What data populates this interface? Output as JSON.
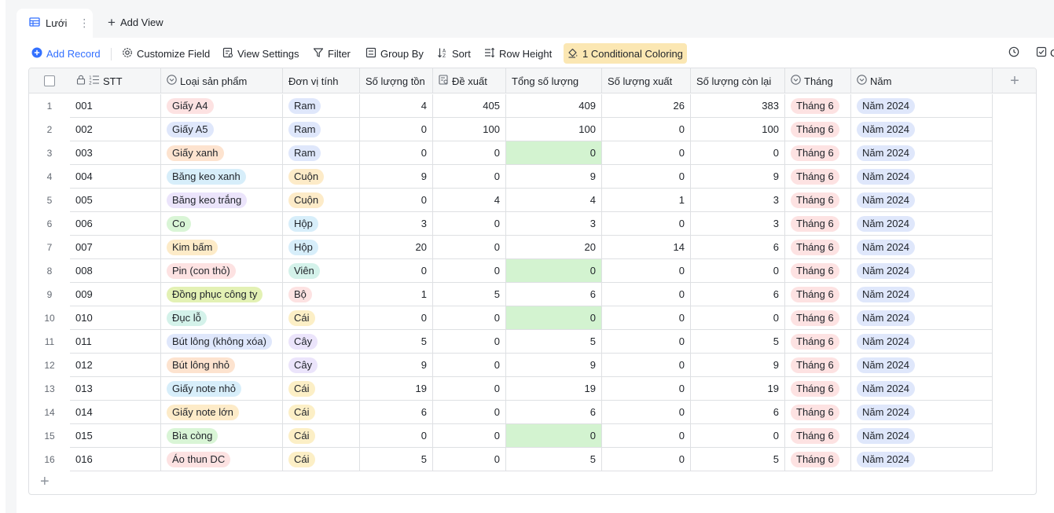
{
  "view_tab": {
    "label": "Lưới",
    "more": "⋮"
  },
  "add_view_label": "Add View",
  "toolbar": {
    "add_record": "Add Record",
    "customize_field": "Customize Field",
    "view_settings": "View Settings",
    "filter": "Filter",
    "group_by": "Group By",
    "sort": "Sort",
    "row_height": "Row Height",
    "conditional_coloring": "1 Conditional Coloring",
    "cut_text": "C"
  },
  "columns": [
    {
      "key": "stt",
      "label": "STT"
    },
    {
      "key": "loai",
      "label": "Loại sản phẩm"
    },
    {
      "key": "dvt",
      "label": "Đơn vị tính"
    },
    {
      "key": "ton",
      "label": "Số lượng tồn"
    },
    {
      "key": "dexuat",
      "label": "Đề xuất"
    },
    {
      "key": "tong",
      "label": "Tổng số lượng"
    },
    {
      "key": "xuat",
      "label": "Số lượng xuất"
    },
    {
      "key": "conlai",
      "label": "Số lượng còn lại"
    },
    {
      "key": "thang",
      "label": "Tháng"
    },
    {
      "key": "nam",
      "label": "Năm"
    }
  ],
  "colors": {
    "accent": "#3370ff",
    "highlight": "#d3f3d0",
    "unit_ram": "#dfe7fb",
    "unit_cuon": "#fdebc8",
    "unit_hop": "#d7eefa",
    "unit_vien": "#d4f2ea",
    "unit_bo": "#fde2e2",
    "unit_cai": "#fcefc6",
    "unit_cay": "#ebe4fb",
    "thang": "#fde2e2",
    "nam": "#dfe7fb"
  },
  "rows": [
    {
      "n": "1",
      "stt": "001",
      "loai": "Giấy A4",
      "loai_color": "#fde2e2",
      "dvt": "Ram",
      "ton": "4",
      "dexuat": "405",
      "tong": "409",
      "xuat": "26",
      "conlai": "383",
      "thang": "Tháng 6",
      "nam": "Năm 2024",
      "hl": false
    },
    {
      "n": "2",
      "stt": "002",
      "loai": "Giấy A5",
      "loai_color": "#dfe7fb",
      "dvt": "Ram",
      "ton": "0",
      "dexuat": "100",
      "tong": "100",
      "xuat": "0",
      "conlai": "100",
      "thang": "Tháng 6",
      "nam": "Năm 2024",
      "hl": false
    },
    {
      "n": "3",
      "stt": "003",
      "loai": "Giấy xanh",
      "loai_color": "#fde3cf",
      "dvt": "Ram",
      "ton": "0",
      "dexuat": "0",
      "tong": "0",
      "xuat": "0",
      "conlai": "0",
      "thang": "Tháng 6",
      "nam": "Năm 2024",
      "hl": true
    },
    {
      "n": "4",
      "stt": "004",
      "loai": "Băng keo xanh",
      "loai_color": "#d7eefa",
      "dvt": "Cuộn",
      "ton": "9",
      "dexuat": "0",
      "tong": "9",
      "xuat": "0",
      "conlai": "9",
      "thang": "Tháng 6",
      "nam": "Năm 2024",
      "hl": false
    },
    {
      "n": "5",
      "stt": "005",
      "loai": "Băng keo trắng",
      "loai_color": "#ebe4fb",
      "dvt": "Cuộn",
      "ton": "0",
      "dexuat": "4",
      "tong": "4",
      "xuat": "1",
      "conlai": "3",
      "thang": "Tháng 6",
      "nam": "Năm 2024",
      "hl": false
    },
    {
      "n": "6",
      "stt": "006",
      "loai": "Co",
      "loai_color": "#d9f5d6",
      "dvt": "Hộp",
      "ton": "3",
      "dexuat": "0",
      "tong": "3",
      "xuat": "0",
      "conlai": "3",
      "thang": "Tháng 6",
      "nam": "Năm 2024",
      "hl": false
    },
    {
      "n": "7",
      "stt": "007",
      "loai": "Kim bấm",
      "loai_color": "#fdebc8",
      "dvt": "Hộp",
      "ton": "20",
      "dexuat": "0",
      "tong": "20",
      "xuat": "14",
      "conlai": "6",
      "thang": "Tháng 6",
      "nam": "Năm 2024",
      "hl": false
    },
    {
      "n": "8",
      "stt": "008",
      "loai": "Pin (con thỏ)",
      "loai_color": "#fde2e2",
      "dvt": "Viên",
      "ton": "0",
      "dexuat": "0",
      "tong": "0",
      "xuat": "0",
      "conlai": "0",
      "thang": "Tháng 6",
      "nam": "Năm 2024",
      "hl": true
    },
    {
      "n": "9",
      "stt": "009",
      "loai": "Đồng phục công ty",
      "loai_color": "#e3f1b4",
      "dvt": "Bộ",
      "ton": "1",
      "dexuat": "5",
      "tong": "6",
      "xuat": "0",
      "conlai": "6",
      "thang": "Tháng 6",
      "nam": "Năm 2024",
      "hl": false
    },
    {
      "n": "10",
      "stt": "010",
      "loai": "Đục lỗ",
      "loai_color": "#d4f2ea",
      "dvt": "Cái",
      "ton": "0",
      "dexuat": "0",
      "tong": "0",
      "xuat": "0",
      "conlai": "0",
      "thang": "Tháng 6",
      "nam": "Năm 2024",
      "hl": true
    },
    {
      "n": "11",
      "stt": "011",
      "loai": "Bút lông (không xóa)",
      "loai_color": "#dfe7fb",
      "dvt": "Cây",
      "ton": "5",
      "dexuat": "0",
      "tong": "5",
      "xuat": "0",
      "conlai": "5",
      "thang": "Tháng 6",
      "nam": "Năm 2024",
      "hl": false
    },
    {
      "n": "12",
      "stt": "012",
      "loai": "Bút lông nhỏ",
      "loai_color": "#fde3cf",
      "dvt": "Cây",
      "ton": "9",
      "dexuat": "0",
      "tong": "9",
      "xuat": "0",
      "conlai": "9",
      "thang": "Tháng 6",
      "nam": "Năm 2024",
      "hl": false
    },
    {
      "n": "13",
      "stt": "013",
      "loai": "Giấy note nhỏ",
      "loai_color": "#d7eefa",
      "dvt": "Cái",
      "ton": "19",
      "dexuat": "0",
      "tong": "19",
      "xuat": "0",
      "conlai": "19",
      "thang": "Tháng 6",
      "nam": "Năm 2024",
      "hl": false
    },
    {
      "n": "14",
      "stt": "014",
      "loai": "Giấy note lớn",
      "loai_color": "#fdebc8",
      "dvt": "Cái",
      "ton": "6",
      "dexuat": "0",
      "tong": "6",
      "xuat": "0",
      "conlai": "6",
      "thang": "Tháng 6",
      "nam": "Năm 2024",
      "hl": false
    },
    {
      "n": "15",
      "stt": "015",
      "loai": "Bìa còng",
      "loai_color": "#d9f5d6",
      "dvt": "Cái",
      "ton": "0",
      "dexuat": "0",
      "tong": "0",
      "xuat": "0",
      "conlai": "0",
      "thang": "Tháng 6",
      "nam": "Năm 2024",
      "hl": true
    },
    {
      "n": "16",
      "stt": "016",
      "loai": "Áo thun DC",
      "loai_color": "#fde2e2",
      "dvt": "Cái",
      "ton": "5",
      "dexuat": "0",
      "tong": "5",
      "xuat": "0",
      "conlai": "5",
      "thang": "Tháng 6",
      "nam": "Năm 2024",
      "hl": false
    }
  ]
}
